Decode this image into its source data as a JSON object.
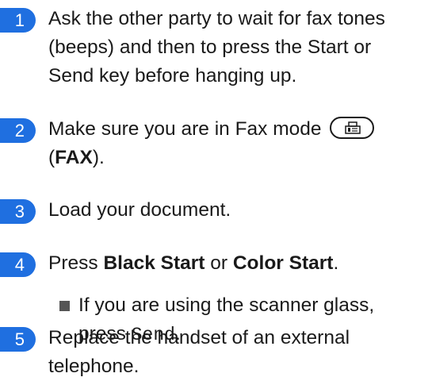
{
  "steps": [
    {
      "number": "1",
      "lines": [
        "Ask the other party to wait for fax tones",
        "(beeps) and then to press the Start or",
        "Send key before hanging up."
      ]
    },
    {
      "number": "2",
      "line1": "Make sure you are in Fax mode",
      "line2_open": "(",
      "line2_bold": "FAX",
      "line2_close": ").",
      "icon": "fax-icon"
    },
    {
      "number": "3",
      "text": "Load your document."
    },
    {
      "number": "4",
      "press": "Press ",
      "black_start": "Black Start",
      "or": " or ",
      "color_start": "Color Start",
      "period": ".",
      "sub": {
        "line1": "If you are using the scanner glass,",
        "press": "press ",
        "send": "Send",
        "period": "."
      }
    },
    {
      "number": "5",
      "lines": [
        "Replace the handset of an external",
        "telephone."
      ]
    }
  ],
  "colors": {
    "badge": "#1f6fe0",
    "text": "#1a1a1a",
    "bullet": "#555555"
  }
}
